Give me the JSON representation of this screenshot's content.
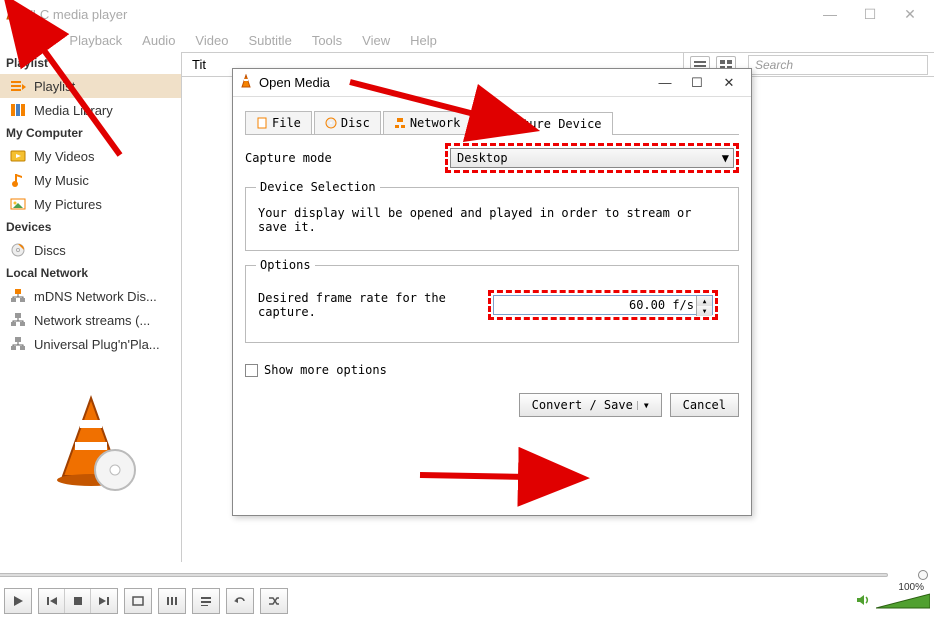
{
  "titlebar": {
    "title": "VLC media player"
  },
  "menubar": {
    "items": [
      "Media",
      "Playback",
      "Audio",
      "Video",
      "Subtitle",
      "Tools",
      "View",
      "Help"
    ]
  },
  "sidebar": {
    "hdr_playlist": "Playlist",
    "items_playlist": [
      {
        "label": "Playlist",
        "icon": "playlist"
      },
      {
        "label": "Media Library",
        "icon": "medialib"
      }
    ],
    "hdr_computer": "My Computer",
    "items_computer": [
      {
        "label": "My Videos",
        "icon": "video"
      },
      {
        "label": "My Music",
        "icon": "music"
      },
      {
        "label": "My Pictures",
        "icon": "pictures"
      }
    ],
    "hdr_devices": "Devices",
    "items_devices": [
      {
        "label": "Discs",
        "icon": "disc"
      }
    ],
    "hdr_localnet": "Local Network",
    "items_localnet": [
      {
        "label": "mDNS Network Dis...",
        "icon": "net"
      },
      {
        "label": "Network streams (...",
        "icon": "net"
      },
      {
        "label": "Universal Plug'n'Pla...",
        "icon": "net"
      }
    ]
  },
  "content": {
    "title_col": "Tit",
    "search_placeholder": "Search"
  },
  "dialog": {
    "title": "Open Media",
    "tabs": {
      "file": "File",
      "disc": "Disc",
      "network": "Network",
      "capture": "Capture Device"
    },
    "capture_mode_label": "Capture mode",
    "capture_mode_value": "Desktop",
    "device_selection_legend": "Device Selection",
    "device_selection_text": "Your display will be opened and played in order to stream or save it.",
    "options_legend": "Options",
    "frame_rate_label": "Desired frame rate for the capture.",
    "frame_rate_value": "60.00 f/s",
    "show_more_options": "Show more options",
    "convert_save": "Convert / Save",
    "cancel": "Cancel"
  },
  "controls": {
    "volume_pct": "100%"
  }
}
